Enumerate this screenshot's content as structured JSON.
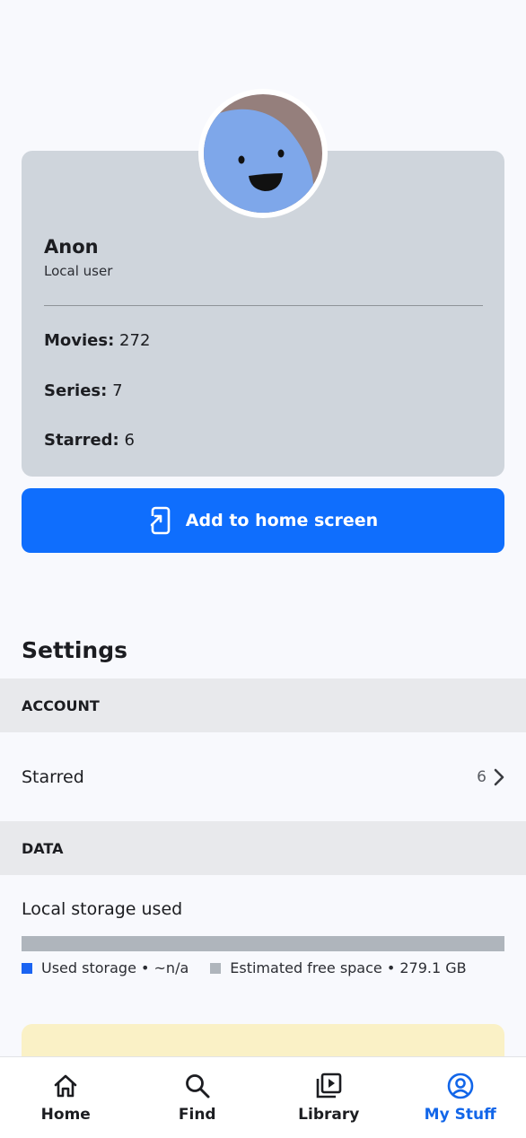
{
  "profile": {
    "name": "Anon",
    "subtitle": "Local user",
    "stats": [
      {
        "label": "Movies:",
        "value": "272"
      },
      {
        "label": "Series:",
        "value": "7"
      },
      {
        "label": "Starred:",
        "value": "6"
      }
    ]
  },
  "add_home_button": {
    "label": "Add to home screen",
    "icon": "add-to-home-icon"
  },
  "settings": {
    "title": "Settings",
    "account_header": "ACCOUNT",
    "starred": {
      "label": "Starred",
      "count": "6"
    },
    "data_header": "DATA",
    "storage": {
      "label": "Local storage used",
      "used_fraction": 0,
      "used_legend": "Used storage • ~n/a",
      "free_legend": "Estimated free space • 279.1 GB"
    }
  },
  "nav": {
    "items": [
      {
        "label": "Home",
        "icon": "home-icon"
      },
      {
        "label": "Find",
        "icon": "search-icon"
      },
      {
        "label": "Library",
        "icon": "library-icon"
      },
      {
        "label": "My Stuff",
        "icon": "account-circle-icon",
        "active": true
      }
    ]
  },
  "colors": {
    "accent": "#0f6efd",
    "active_nav": "#1266e9",
    "card": "#cfd5dc",
    "used_storage": "#1b64f2",
    "free_storage": "#afb5bc",
    "notice": "#faf1c6"
  }
}
